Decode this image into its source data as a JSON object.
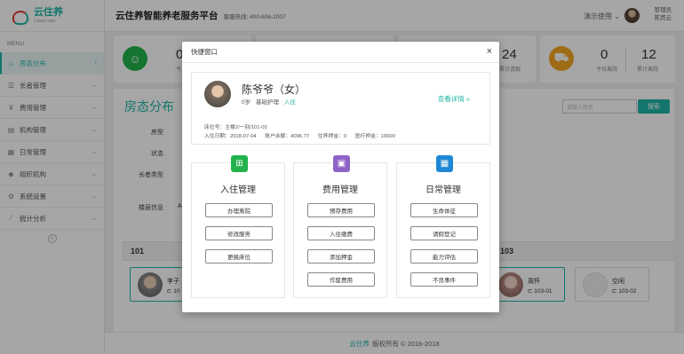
{
  "brand": {
    "logo_cn": "云住养",
    "logo_en": "Cloud care"
  },
  "topbar": {
    "platform": "云住养智能养老服务平台",
    "hotline": "客服热线: 400-606-2007",
    "demo_user": "演示使用 ⌄",
    "admin_role": "管理员",
    "admin_name": "陈宾云"
  },
  "sidebar": {
    "menu_title": "MENU",
    "items": [
      {
        "label": "房态分布",
        "icon": "house-icon",
        "active": true
      },
      {
        "label": "长者管理",
        "icon": "list-icon"
      },
      {
        "label": "费用管理",
        "icon": "yen-icon"
      },
      {
        "label": "机构管理",
        "icon": "building-icon"
      },
      {
        "label": "日常管理",
        "icon": "calendar-icon"
      },
      {
        "label": "组织机构",
        "icon": "people-icon"
      },
      {
        "label": "系统设置",
        "icon": "gear-icon"
      },
      {
        "label": "统计分析",
        "icon": "chart-icon"
      }
    ]
  },
  "stats": {
    "card1_num": "0",
    "card1_lbl": "今日",
    "card3_num": "24",
    "card3_lbl": "累计请假",
    "card4_num1": "0",
    "card4_lbl1": "今日离院",
    "card4_num2": "12",
    "card4_lbl2": "累计离院"
  },
  "panel": {
    "title": "房态分布",
    "search_placeholder": "请输入姓名",
    "search_btn": "搜索",
    "filters": {
      "room_type": "房型",
      "status": "状态",
      "elder_type": "长者类型",
      "floor": "楼层信息",
      "floor_val": "A"
    },
    "rooms": {
      "r101": "101",
      "r103": "103"
    },
    "beds": [
      {
        "name": "李子",
        "no": "10"
      },
      {
        "name": "周怀",
        "no": "103-01"
      },
      {
        "name": "空闲",
        "no": "103-02"
      }
    ]
  },
  "footer": {
    "brand": "云住养",
    "copyright": "版权所有 © 2016-2018"
  },
  "modal": {
    "title": "快捷窗口",
    "close": "×",
    "elder": {
      "name": "陈爷爷（女）",
      "age": "0岁",
      "care": "基础护理",
      "status": "入住",
      "detail_link": "查看详情 »",
      "bed": "床位号：主楼2/一别/101-02",
      "checkin": "入住日期：2018-07-04",
      "balance": "账户余额：4096.77",
      "deposit": "住养押金：0",
      "medical": "医疗押金：10000"
    },
    "cards": [
      {
        "title": "入住管理",
        "color": "#22b24c",
        "icon": "bed-plus-icon",
        "buttons": [
          "办理离院",
          "修改服务",
          "更换床位"
        ]
      },
      {
        "title": "费用管理",
        "color": "#8e63c7",
        "icon": "wallet-icon",
        "buttons": [
          "预存费用",
          "入住缴费",
          "添加押金",
          "作废费用"
        ]
      },
      {
        "title": "日常管理",
        "color": "#1e88d6",
        "icon": "calendar-icon",
        "buttons": [
          "生命体征",
          "请假登记",
          "能力评估",
          "不良事件"
        ]
      }
    ]
  },
  "colors": {
    "accent": "#1fb5a6",
    "green": "#22b24c",
    "purple": "#8e63c7",
    "blue": "#1e88d6",
    "orange": "#f5a623"
  }
}
